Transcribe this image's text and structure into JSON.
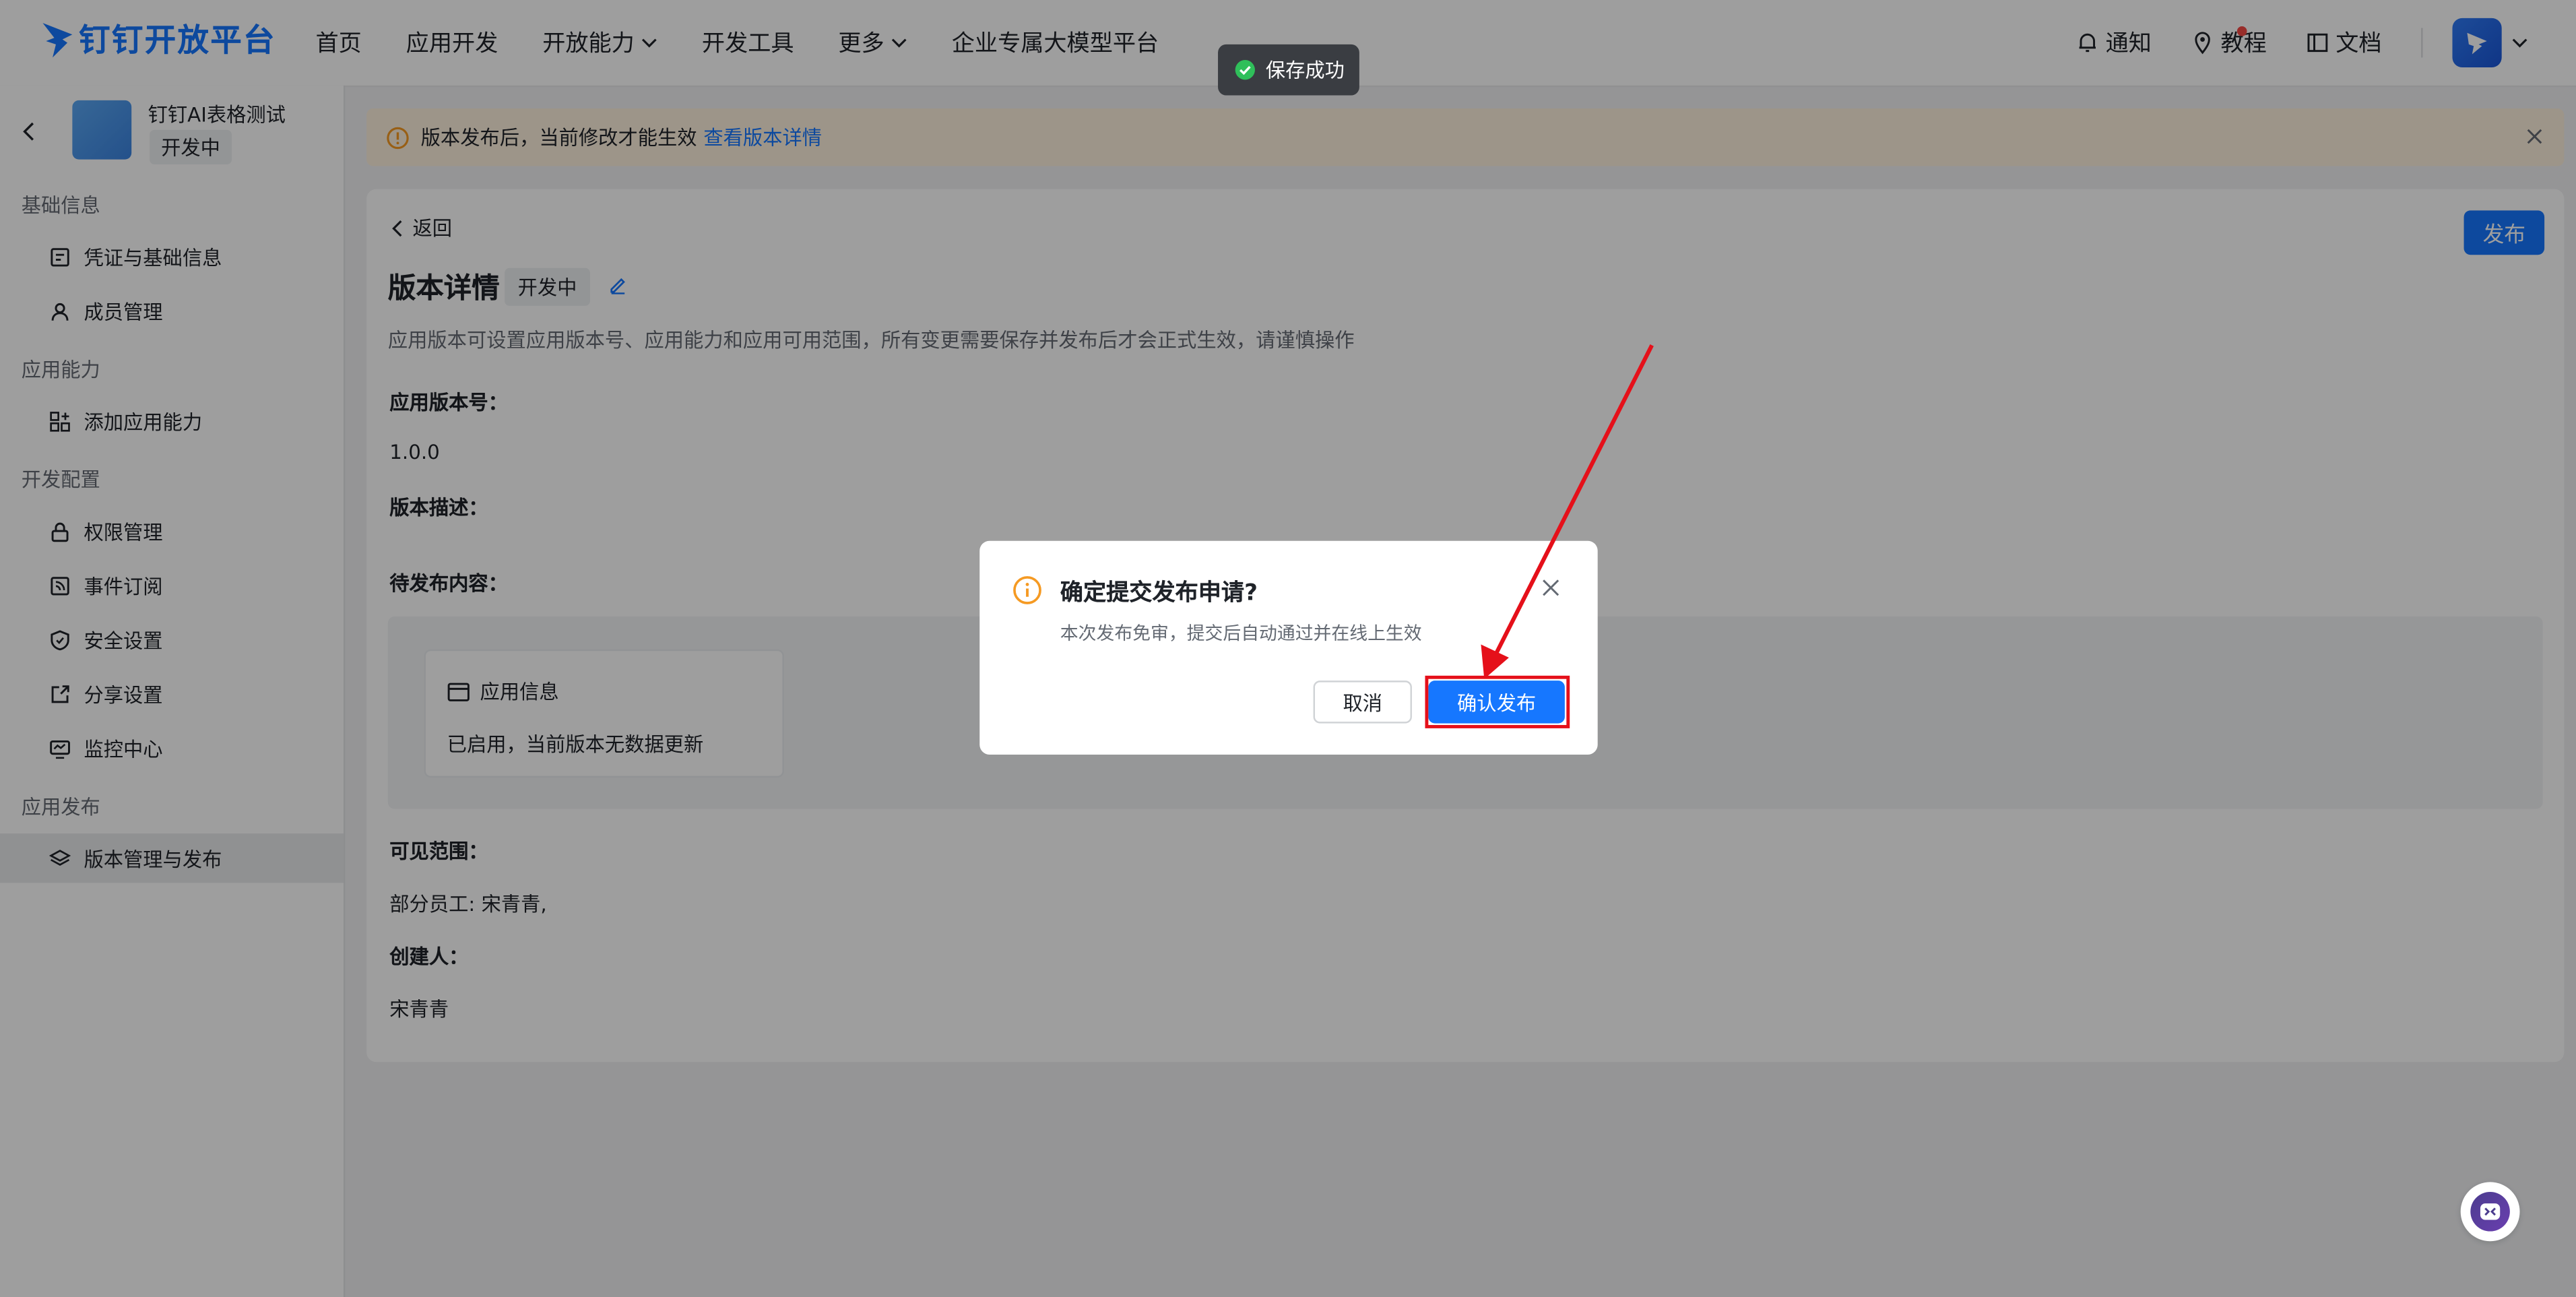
{
  "nav": {
    "logo_text": "钉钉开放平台",
    "items": [
      "首页",
      "应用开发",
      "开放能力",
      "开发工具",
      "更多",
      "企业专属大模型平台"
    ],
    "right": {
      "notify": "通知",
      "tutorial": "教程",
      "docs": "文档"
    }
  },
  "sidebar": {
    "app_name": "钉钉AI表格测试",
    "app_status": "开发中",
    "sections": [
      {
        "title": "基础信息",
        "items": [
          "凭证与基础信息",
          "成员管理"
        ]
      },
      {
        "title": "应用能力",
        "items": [
          "添加应用能力"
        ]
      },
      {
        "title": "开发配置",
        "items": [
          "权限管理",
          "事件订阅",
          "安全设置",
          "分享设置",
          "监控中心"
        ]
      },
      {
        "title": "应用发布",
        "items": [
          "版本管理与发布"
        ]
      }
    ],
    "active_item": "版本管理与发布"
  },
  "notice": {
    "text": "版本发布后，当前修改才能生效",
    "link": "查看版本详情"
  },
  "detail": {
    "back": "返回",
    "publish": "发布",
    "title": "版本详情",
    "status": "开发中",
    "description": "应用版本可设置应用版本号、应用能力和应用可用范围，所有变更需要保存并发布后才会正式生效，请谨慎操作",
    "version_label": "应用版本号：",
    "version_value": "1.0.0",
    "desc_label": "版本描述：",
    "pending_label": "待发布内容：",
    "pending_card": {
      "title": "应用信息",
      "body": "已启用，当前版本无数据更新"
    },
    "scope_label": "可见范围：",
    "scope_value": "部分员工: 宋青青,",
    "creator_label": "创建人：",
    "creator_value": "宋青青"
  },
  "toast": {
    "text": "保存成功"
  },
  "dialog": {
    "title": "确定提交发布申请?",
    "subtitle": "本次发布免审，提交后自动通过并在线上生效",
    "cancel": "取消",
    "confirm": "确认发布"
  },
  "colors": {
    "primary": "#1677ff",
    "warning": "#f59a23",
    "annotation": "#e5101a"
  }
}
